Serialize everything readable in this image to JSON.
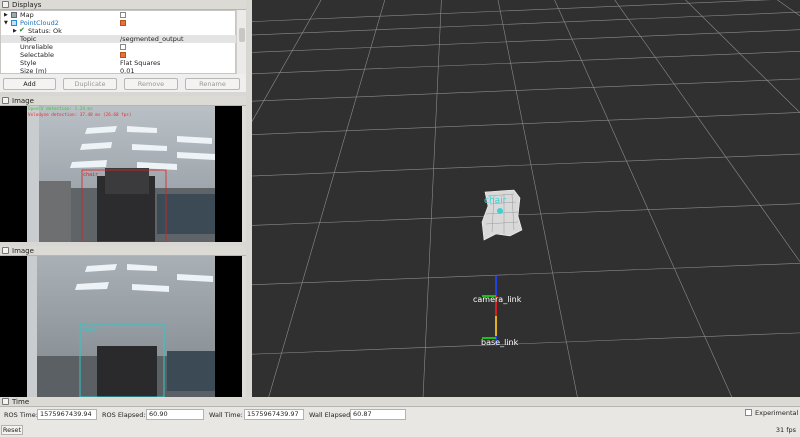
{
  "displays": {
    "title": "Displays",
    "rows": [
      {
        "label": "Map",
        "type": "display",
        "checked": false
      },
      {
        "label": "PointCloud2",
        "type": "display",
        "checked": true
      },
      {
        "label": "Status: Ok",
        "type": "status"
      },
      {
        "label": "Topic",
        "value": "/segmented_output"
      },
      {
        "label": "Unreliable",
        "checked": false
      },
      {
        "label": "Selectable",
        "checked": true
      },
      {
        "label": "Style",
        "value": "Flat Squares"
      },
      {
        "label": "Size (m)",
        "value": "0.01"
      }
    ],
    "buttons": {
      "add": "Add",
      "duplicate": "Duplicate",
      "remove": "Remove",
      "rename": "Rename"
    }
  },
  "image_panels": [
    {
      "title": "Image",
      "overlay_line1": "OpenCV detection: 1.24 ms",
      "overlay_line2": "Velodyne detection: 37.48 ms (26.68 fps)",
      "detection_label": "chair"
    },
    {
      "title": "Image",
      "detection_label": "chair"
    }
  ],
  "view3d": {
    "labels": {
      "cluster": "chair",
      "camera": "camera_link",
      "base": "base_link"
    },
    "colors": {
      "background": "#303030",
      "grid": "#8c8c8c",
      "x_axis": "#d62020",
      "y_axis": "#18c018",
      "z_axis": "#2040e0",
      "cluster_label": "#3ed0d0"
    }
  },
  "time": {
    "title": "Time",
    "ros_time_label": "ROS Time:",
    "ros_time": "1575967439.94",
    "ros_elapsed_label": "ROS Elapsed:",
    "ros_elapsed": "60.90",
    "wall_time_label": "Wall Time:",
    "wall_time": "1575967439.97",
    "wall_elapsed_label": "Wall Elapsed:",
    "wall_elapsed": "60.87",
    "experimental_label": "Experimental",
    "reset_label": "Reset",
    "fps": "31 fps"
  }
}
